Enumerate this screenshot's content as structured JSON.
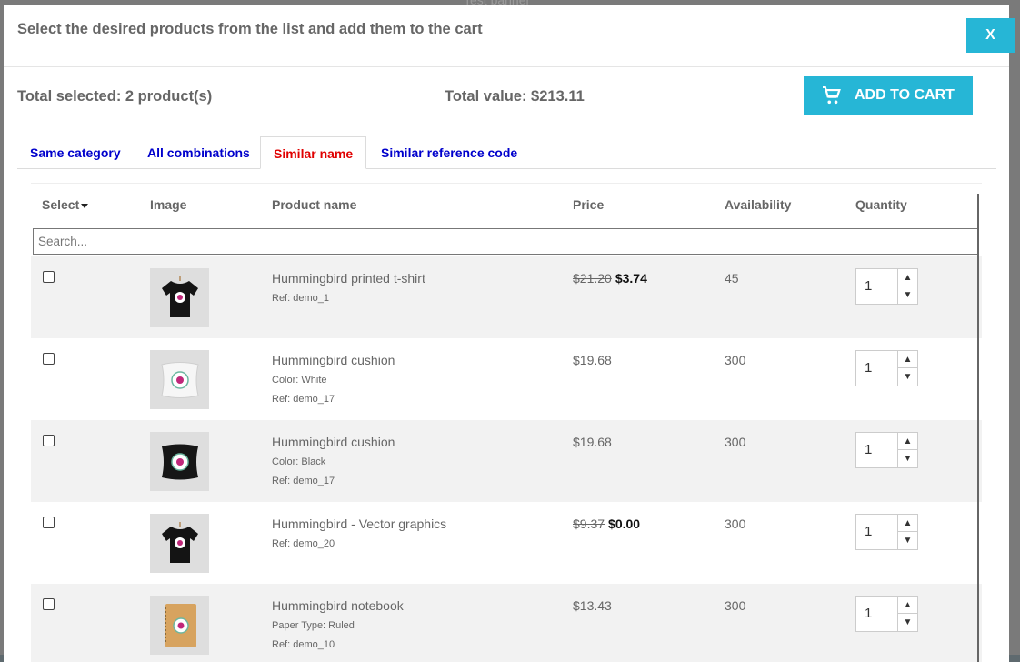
{
  "backdrop": {
    "banner_text": "Test banner"
  },
  "modal": {
    "title": "Select the desired products from the list and add them to the cart",
    "close_label": "X"
  },
  "summary": {
    "total_selected": "Total selected: 2 product(s)",
    "total_value": "Total value: $213.11",
    "add_to_cart_label": "ADD TO CART"
  },
  "tabs": [
    {
      "label": "Same category",
      "active": false
    },
    {
      "label": "All combinations",
      "active": false
    },
    {
      "label": "Similar name",
      "active": true
    },
    {
      "label": "Similar reference code",
      "active": false
    }
  ],
  "table": {
    "headers": {
      "select": "Select",
      "image": "Image",
      "product_name": "Product name",
      "price": "Price",
      "availability": "Availability",
      "quantity": "Quantity"
    },
    "search_placeholder": "Search...",
    "rows": [
      {
        "name": "Hummingbird printed t-shirt",
        "meta1": "Ref: demo_1",
        "meta2": "",
        "old_price": "$21.20",
        "price": "$3.74",
        "availability": "45",
        "quantity": "1",
        "thumb": "tshirt-black"
      },
      {
        "name": "Hummingbird cushion",
        "meta1": "Color: White",
        "meta2": "Ref: demo_17",
        "old_price": "",
        "price": "$19.68",
        "availability": "300",
        "quantity": "1",
        "thumb": "cushion-white"
      },
      {
        "name": "Hummingbird cushion",
        "meta1": "Color: Black",
        "meta2": "Ref: demo_17",
        "old_price": "",
        "price": "$19.68",
        "availability": "300",
        "quantity": "1",
        "thumb": "cushion-black"
      },
      {
        "name": "Hummingbird - Vector graphics",
        "meta1": "Ref: demo_20",
        "meta2": "",
        "old_price": "$9.37",
        "price": "$0.00",
        "availability": "300",
        "quantity": "1",
        "thumb": "tshirt-black"
      },
      {
        "name": "Hummingbird notebook",
        "meta1": "Paper Type: Ruled",
        "meta2": "Ref: demo_10",
        "old_price": "",
        "price": "$13.43",
        "availability": "300",
        "quantity": "1",
        "thumb": "notebook"
      }
    ]
  },
  "colors": {
    "accent": "#26b6d6",
    "tab_link": "#0000cc",
    "tab_active": "#e00000"
  }
}
